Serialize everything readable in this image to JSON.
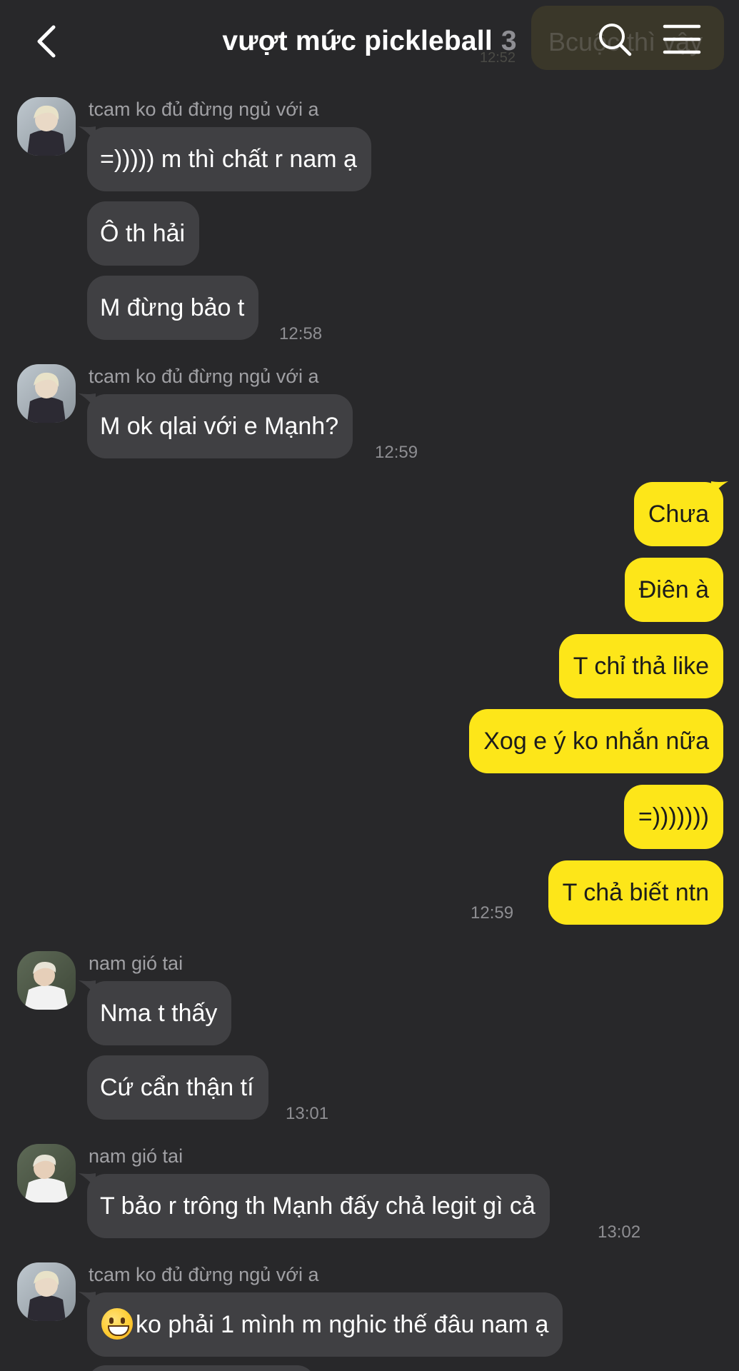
{
  "header": {
    "title": "vượt mức pickleball",
    "member_count": "3",
    "notice_text": "Bcuộc thì vậy",
    "ghost_time": "12:52"
  },
  "messages": [
    {
      "sender": "tcam ko đủ đừng ngủ với a",
      "texts": [
        "=))))) m thì chất r nam ạ",
        "Ô th hải",
        "M đừng bảo t"
      ],
      "time": "12:58"
    },
    {
      "sender": "tcam ko đủ đừng ngủ với a",
      "texts": [
        "M ok qlai với e Mạnh?"
      ],
      "time": "12:59"
    },
    {
      "texts": [
        "Chưa",
        "Điên à",
        "T chỉ thả like",
        "Xog e ý ko nhắn nữa",
        "=)))))))",
        "T chả biết ntn"
      ],
      "time": "12:59"
    },
    {
      "sender": "nam gió tai",
      "texts": [
        "Nma t thấy",
        "Cứ cẩn thận tí"
      ],
      "time": "13:01"
    },
    {
      "sender": "nam gió tai",
      "texts": [
        "T bảo r trông th Mạnh đấy chả legit gì cả"
      ],
      "time": "13:02"
    },
    {
      "sender": "tcam ko đủ đừng ngủ với a",
      "texts": [
        "ko phải 1 mình m nghic thế đâu nam ạ"
      ],
      "emoji": "grinning-face"
    }
  ],
  "colors": {
    "background": "#28282a",
    "incoming_bubble": "#404043",
    "outgoing_bubble": "#fde619",
    "meta_text": "#8e8e92"
  }
}
